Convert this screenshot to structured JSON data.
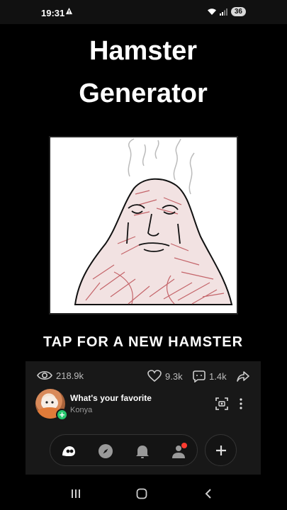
{
  "status": {
    "time": "19:31",
    "battery": "36"
  },
  "post": {
    "title_line1": "Hamster",
    "title_line2": "Generator",
    "tap_label": "TAP FOR A NEW HAMSTER"
  },
  "stats": {
    "views": "218.9k",
    "likes": "9.3k",
    "comments": "1.4k"
  },
  "author": {
    "post_title": "What's your favorite",
    "username": "Konya"
  },
  "icons": {
    "views": "eye-icon",
    "likes": "heart-icon",
    "comments": "comment-icon",
    "share": "share-icon",
    "scan": "scan-icon",
    "more": "more-vertical-icon",
    "nav_home": "app-logo-icon",
    "nav_explore": "compass-icon",
    "nav_notifications": "bell-icon",
    "nav_profile": "profile-icon",
    "create": "plus-icon"
  },
  "colors": {
    "accent_green": "#28c76f",
    "notification_red": "#ff3b30",
    "hamster_red": "#c0585e"
  }
}
